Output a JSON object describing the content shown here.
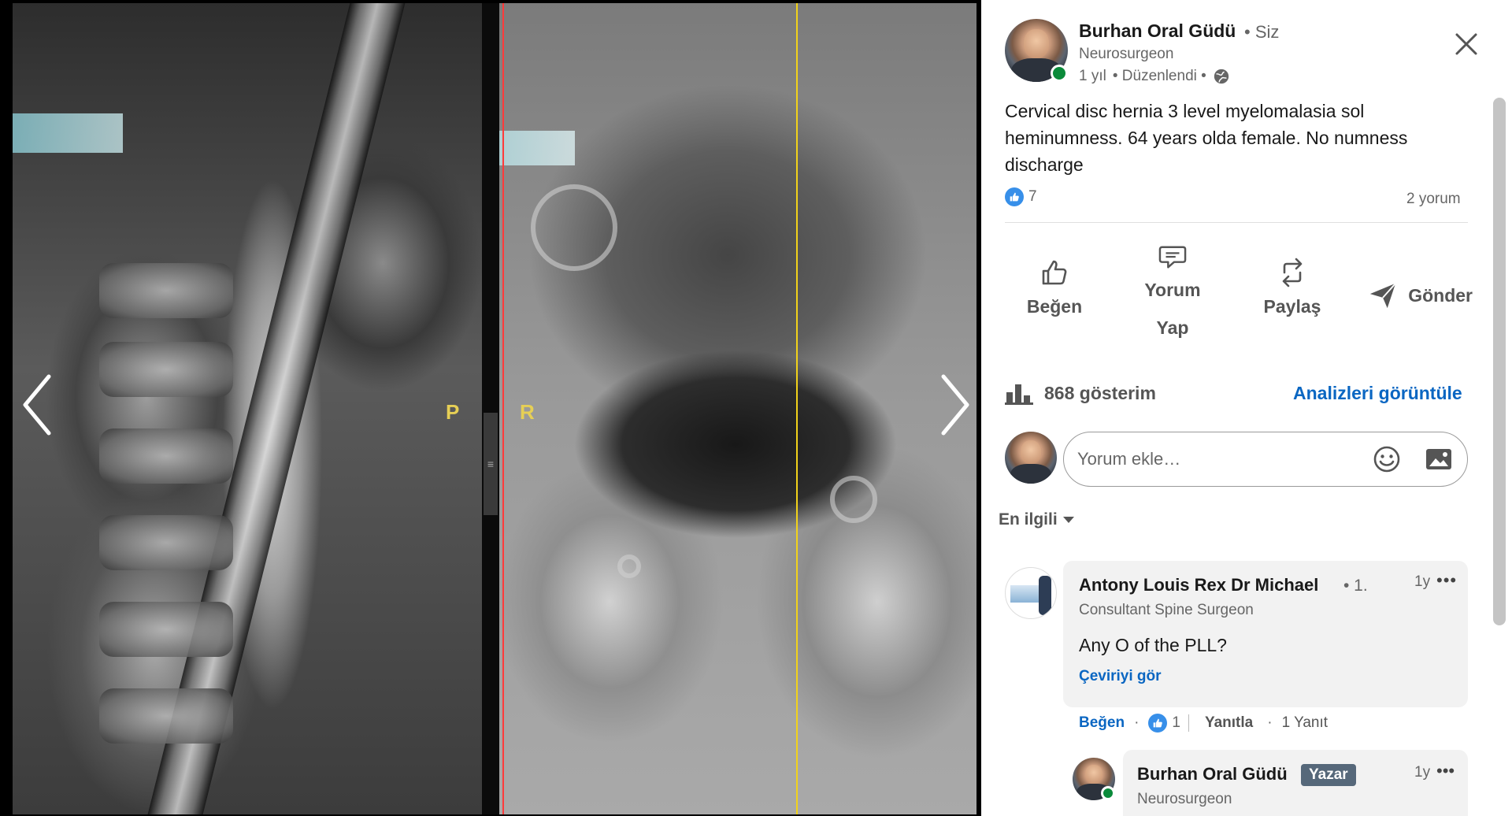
{
  "viewer": {
    "label_p": "P",
    "label_r": "R",
    "prev_icon": "chevron-left-icon",
    "next_icon": "chevron-right-icon"
  },
  "post": {
    "author": "Burhan Oral Güdü",
    "you_label": "• Siz",
    "headline": "Neurosurgeon",
    "time": "1 yıl",
    "edited": "• Düzenlendi •",
    "visibility_icon": "globe-icon",
    "text": "Cervical disc hernia 3 level myelomalasia sol heminumness. 64 years olda female. No numness discharge",
    "reaction_count": "7",
    "comments_count": "2 yorum"
  },
  "actions": {
    "like": "Beğen",
    "comment_line1": "Yorum",
    "comment_line2": "Yap",
    "share": "Paylaş",
    "send": "Gönder"
  },
  "analytics": {
    "impressions": "868 gösterim",
    "link": "Analizleri görüntüle"
  },
  "composer": {
    "placeholder": "Yorum ekle…"
  },
  "sort": {
    "label": "En ilgili"
  },
  "comment": {
    "author": "Antony Louis Rex Dr Michael",
    "degree": "• 1.",
    "time": "1y",
    "more": "•••",
    "headline": "Consultant Spine Surgeon",
    "text": "Any O of the PLL?",
    "translate": "Çeviriyi gör",
    "like": "Beğen",
    "dot": "·",
    "like_count": "1",
    "reply": "Yanıtla",
    "replies": "1 Yanıt"
  },
  "reply": {
    "author": "Burhan Oral Güdü",
    "badge": "Yazar",
    "time": "1y",
    "more": "•••",
    "headline": "Neurosurgeon"
  },
  "colors": {
    "accent": "#0a66c2",
    "like_blue": "#378fe9",
    "online_green": "#0a8a3a",
    "author_badge": "#56687a"
  }
}
